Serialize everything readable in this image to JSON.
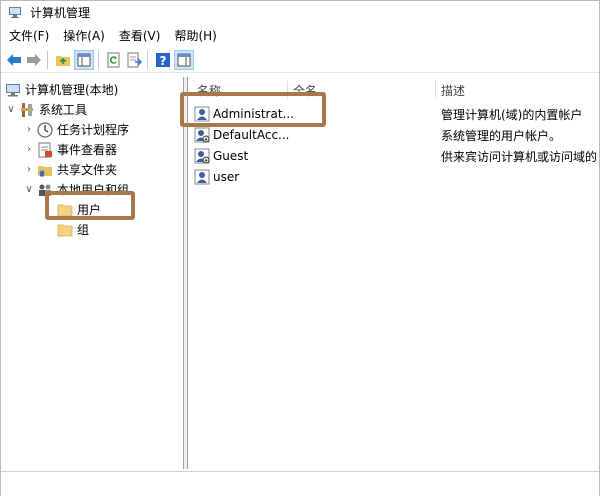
{
  "window": {
    "title": "计算机管理"
  },
  "menu": [
    "文件(F)",
    "操作(A)",
    "查看(V)",
    "帮助(H)"
  ],
  "toolbar": {
    "buttons": [
      "back-icon",
      "forward-icon",
      "up-folder-icon",
      "show-tree-icon",
      "refresh-icon",
      "export-list-icon",
      "help-icon",
      "properties-icon"
    ]
  },
  "tree": {
    "root": "计算机管理(本地)",
    "system_tools": "系统工具",
    "task_scheduler": "任务计划程序",
    "event_viewer": "事件查看器",
    "shared_folders": "共享文件夹",
    "local_users_groups": "本地用户和组",
    "users": "用户",
    "groups": "组"
  },
  "list": {
    "columns": {
      "name": "名称",
      "fullname": "全名",
      "description": "描述"
    },
    "rows": [
      {
        "name": "Administrat...",
        "fullname": "",
        "description": "管理计算机(域)的内置帐户"
      },
      {
        "name": "DefaultAcc...",
        "fullname": "",
        "description": "系统管理的用户帐户。"
      },
      {
        "name": "Guest",
        "fullname": "",
        "description": "供来宾访问计算机或访问域的"
      },
      {
        "name": "user",
        "fullname": "",
        "description": ""
      }
    ]
  },
  "colors": {
    "highlight_box": "#a8784c",
    "folder": "#f1d384"
  }
}
